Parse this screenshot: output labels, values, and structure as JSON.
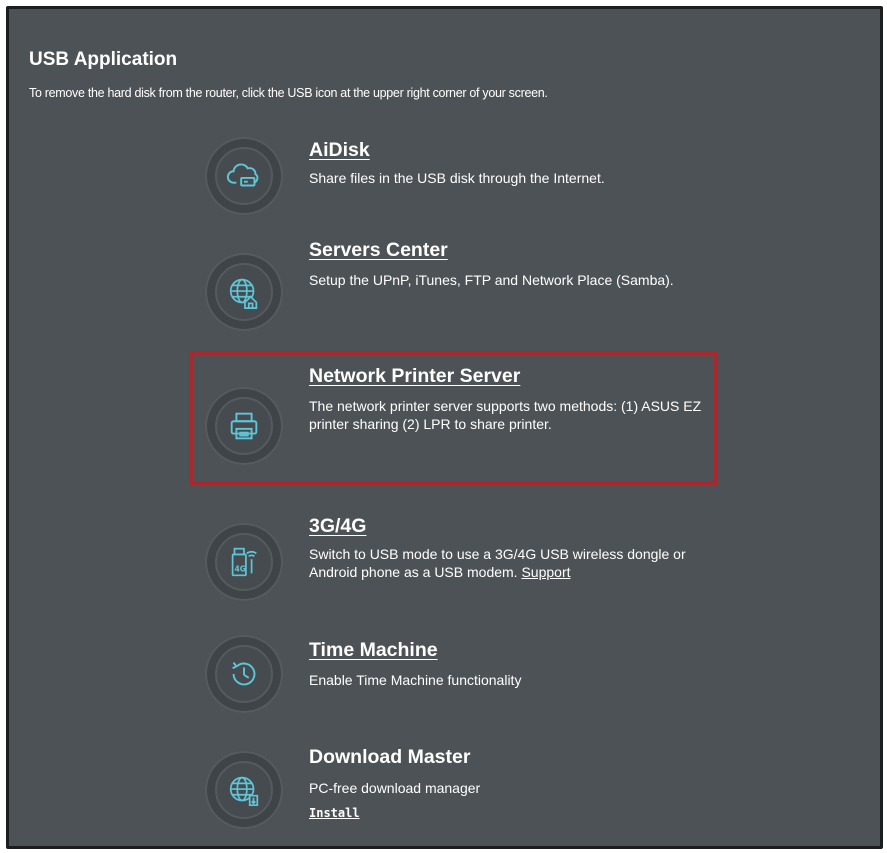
{
  "header": {
    "title": "USB Application",
    "subtitle": "To remove the hard disk from the router, click the USB icon at the upper right corner of your screen."
  },
  "apps": [
    {
      "name": "AiDisk",
      "icon": "cloud-drive-icon",
      "description": "Share files in the USB disk through the Internet."
    },
    {
      "name": "Servers Center",
      "icon": "globe-house-icon",
      "description": "Setup the UPnP, iTunes, FTP and Network Place (Samba)."
    },
    {
      "name": "Network Printer Server",
      "icon": "printer-icon",
      "description": "The network printer server supports two methods: (1) ASUS EZ printer sharing (2) LPR to share printer."
    },
    {
      "name": "3G/4G",
      "icon": "usb-modem-icon",
      "description": "Switch to USB mode to use a 3G/4G USB wireless dongle or Android phone as a USB modem.",
      "link": "Support",
      "badge": "4G"
    },
    {
      "name": "Time Machine",
      "icon": "clock-icon",
      "description": "Enable Time Machine functionality"
    },
    {
      "name": "Download Master",
      "icon": "globe-download-icon",
      "description": "PC-free download manager",
      "action": "Install"
    }
  ],
  "colors": {
    "panel_bg": "#4d5256",
    "icon_accent": "#5fc6d8",
    "highlight": "#a8282e"
  }
}
